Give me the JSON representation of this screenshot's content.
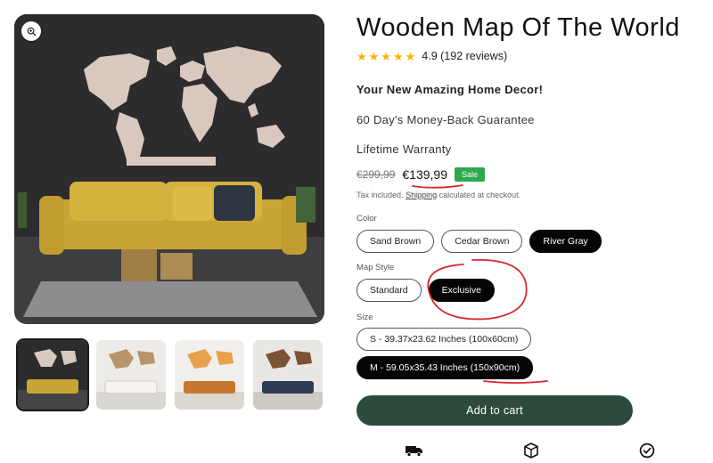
{
  "product": {
    "title": "Wooden Map Of The World",
    "rating_value": 4.9,
    "stars": 5,
    "rating_text": "4.9 (192 reviews)",
    "tagline": "Your New Amazing Home Decor!",
    "guarantee": "60 Day's Money-Back Guarantee",
    "warranty": "Lifetime Warranty"
  },
  "price": {
    "old": "€299,99",
    "current": "€139,99",
    "badge": "Sale",
    "tax_prefix": "Tax included.",
    "tax_link": "Shipping",
    "tax_suffix": "calculated at checkout."
  },
  "options": {
    "color": {
      "label": "Color",
      "values": [
        "Sand Brown",
        "Cedar Brown",
        "River Gray"
      ],
      "selected": "River Gray"
    },
    "style": {
      "label": "Map Style",
      "values": [
        "Standard",
        "Exclusive"
      ],
      "selected": "Exclusive"
    },
    "size": {
      "label": "Size",
      "values": [
        "S - 39.37x23.62 Inches (100x60cm)",
        "M - 59.05x35.43 Inches (150x90cm)"
      ],
      "selected": "M - 59.05x35.43 Inches (150x90cm)"
    }
  },
  "cart": {
    "label": "Add to cart"
  },
  "gallery": {
    "thumbnails": [
      "living-room-yellow-sofa",
      "living-room-white-sofa",
      "living-room-orange-sofa",
      "living-room-navy-sofa"
    ],
    "active_index": 0
  },
  "features": {
    "icons": [
      "delivery-truck-icon",
      "package-box-icon",
      "check-badge-icon"
    ]
  },
  "colors": {
    "cart_button": "#2d4b3c",
    "sale_badge": "#2ea84f",
    "stars": "#f5b400",
    "annotation_red": "#d8262c",
    "selected_pill": "#050505"
  }
}
